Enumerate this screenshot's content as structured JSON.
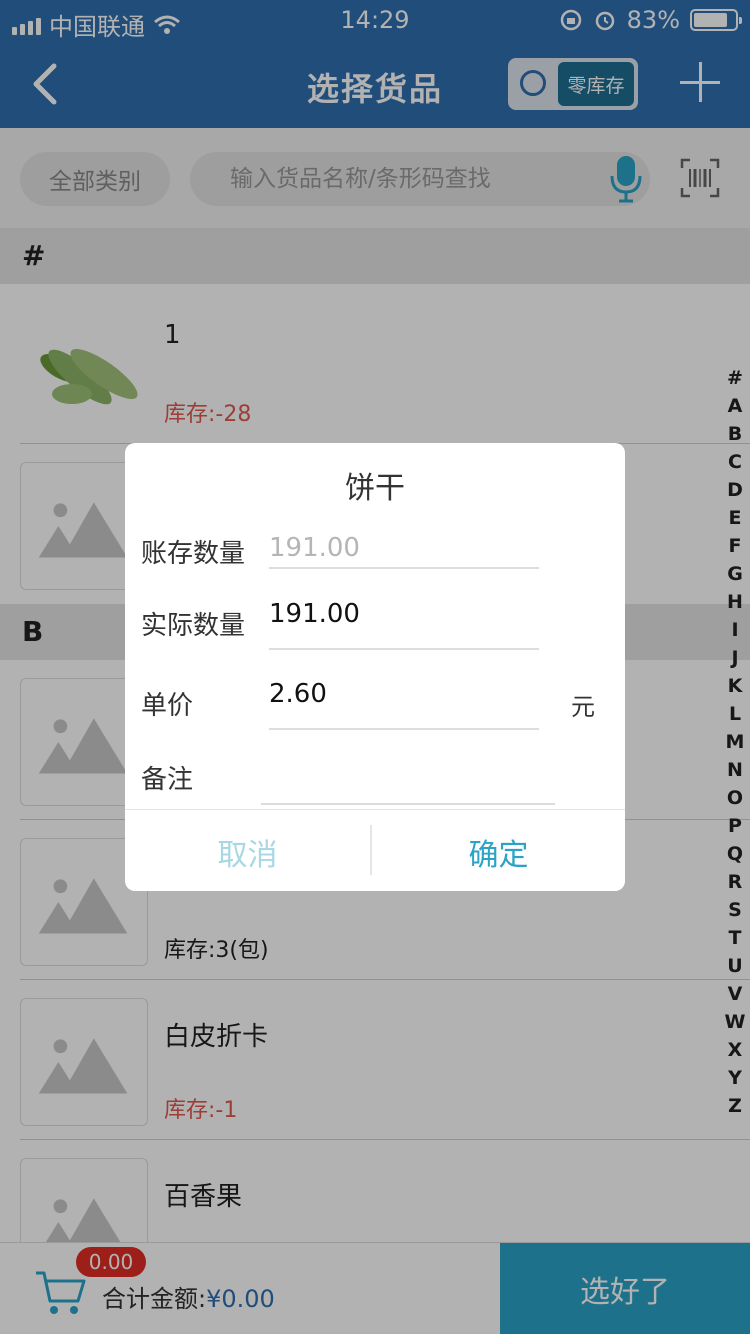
{
  "status_bar": {
    "carrier": "中国联通",
    "time": "14:29",
    "battery_text": "83%",
    "battery_level": 0.83
  },
  "header": {
    "title": "选择货品",
    "zero_stock_label": "零库存"
  },
  "search": {
    "category_label": "全部类别",
    "placeholder": "输入货品名称/条形码查找"
  },
  "sections": [
    {
      "letter": "#"
    },
    {
      "letter": "B"
    }
  ],
  "items": [
    {
      "name": "1",
      "stock": "库存:-28",
      "stock_type": "negative",
      "image": "zucchini"
    },
    {
      "name": "",
      "stock": "",
      "image": "placeholder"
    },
    {
      "name": "",
      "stock": "",
      "image": "placeholder"
    },
    {
      "name": "",
      "stock": "库存:3(包)",
      "stock_type": "positive",
      "image": "placeholder"
    },
    {
      "name": "白皮折卡",
      "stock": "库存:-1",
      "stock_type": "negative",
      "image": "placeholder"
    },
    {
      "name": "百香果",
      "stock": "",
      "image": "placeholder"
    }
  ],
  "index_letters": [
    "#",
    "A",
    "B",
    "C",
    "D",
    "E",
    "F",
    "G",
    "H",
    "I",
    "J",
    "K",
    "L",
    "M",
    "N",
    "O",
    "P",
    "Q",
    "R",
    "S",
    "T",
    "U",
    "V",
    "W",
    "X",
    "Y",
    "Z"
  ],
  "dialog": {
    "title": "饼干",
    "book_qty_label": "账存数量",
    "book_qty_value": "191.00",
    "actual_qty_label": "实际数量",
    "actual_qty_value": "191.00",
    "price_label": "单价",
    "price_value": "2.60",
    "price_unit": "元",
    "note_label": "备注",
    "note_value": "",
    "cancel_label": "取消",
    "confirm_label": "确定"
  },
  "bottom_bar": {
    "cart_badge": "0.00",
    "total_label": "合计金额:",
    "total_value": "¥0.00",
    "done_label": "选好了"
  },
  "colors": {
    "header_bg": "#2f6fae",
    "accent": "#2aa3c6",
    "negative_stock": "#e05a4d",
    "badge": "#e02f24"
  }
}
